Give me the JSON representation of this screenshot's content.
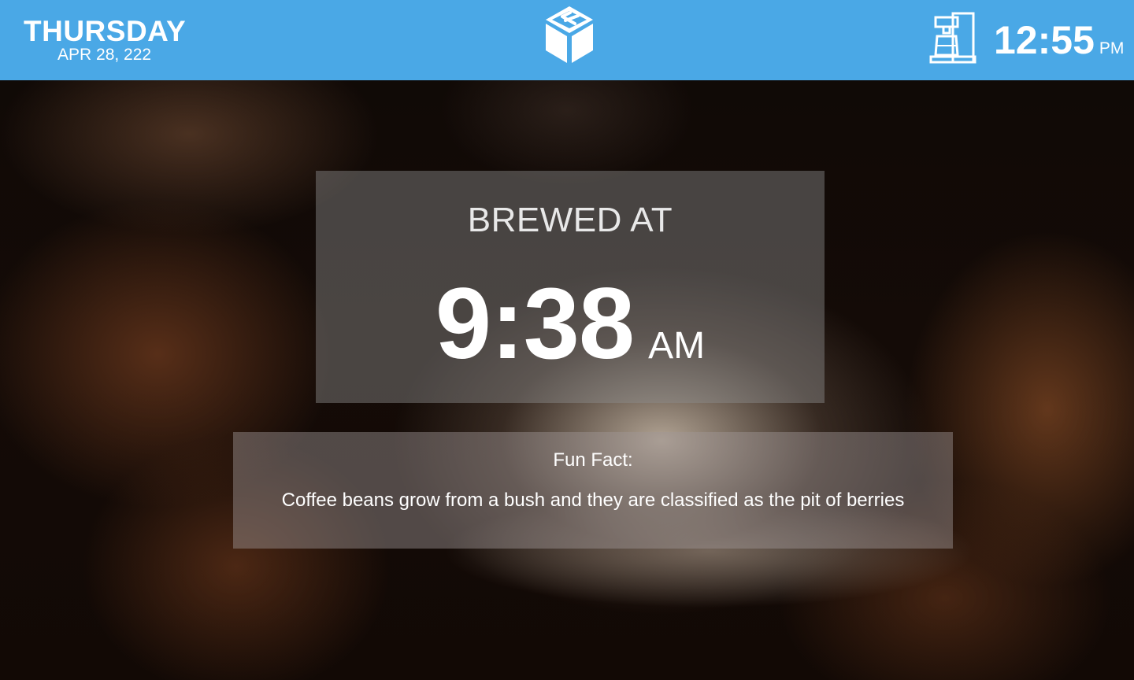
{
  "header": {
    "weekday": "THURSDAY",
    "date": "APR 28, 222",
    "logo_icon": "kiosk-cube-logo",
    "brewer_icon": "coffee-maker-icon",
    "time": "12:55",
    "ampm": "PM",
    "bar_color": "#4aa8e6"
  },
  "brew": {
    "label": "BREWED AT",
    "time": "9:38",
    "ampm": "AM"
  },
  "fact": {
    "title": "Fun Fact:",
    "text": "Coffee beans grow from a bush and they are classified as the pit of berries"
  }
}
